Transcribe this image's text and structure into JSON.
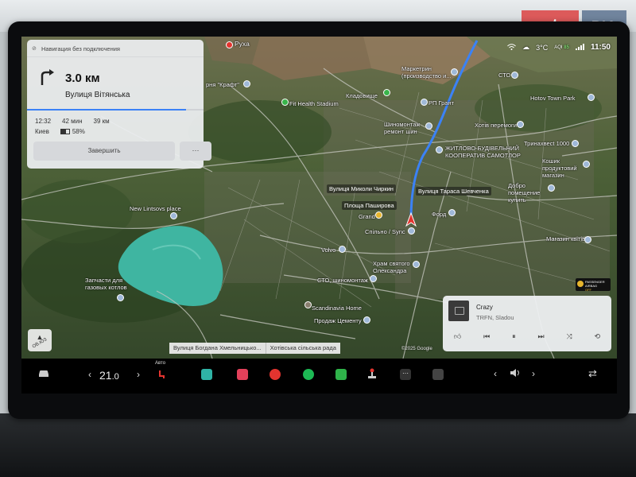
{
  "watermark": {
    "auto": "auto",
    "ria": "RIA"
  },
  "status": {
    "temperature": "3°C",
    "aqi_label": "AQI",
    "aqi_value": "85",
    "time": "11:50"
  },
  "navigation": {
    "header": "Навигация без подключения",
    "distance": "3.0 км",
    "street": "Вулиця Вітянська",
    "arrival_time": "12:32",
    "duration": "42 мин",
    "trip_distance": "39 км",
    "destination": "Киев",
    "battery_percent": "58%",
    "battery_level": 0.58,
    "progress": 0.9,
    "end_button": "Завершить",
    "more_button": "···"
  },
  "map": {
    "labels": [
      {
        "text": "Руха"
      },
      {
        "text": "Маркетрин (производство и..."
      },
      {
        "text": "рня \"Крафт\""
      },
      {
        "text": "Кладовище"
      },
      {
        "text": "Fit Health Stadium"
      },
      {
        "text": "РП Грант"
      },
      {
        "text": "СТО"
      },
      {
        "text": "Hotov Town Park"
      },
      {
        "text": "Шиномонтаж ремонт шин"
      },
      {
        "text": "Хотів перемоги"
      },
      {
        "text": "ЖИТЛОВО-БУДІВЕЛЬНИЙ КООПЕРАТИВ САМОТЛОР"
      },
      {
        "text": "Тринахвесt 1000"
      },
      {
        "text": "Кошик продуктовий магазин"
      },
      {
        "text": "Вулиця Миколи Чиркин"
      },
      {
        "text": "Вулиця Тараса Шевченка"
      },
      {
        "text": "Площа Паширова"
      },
      {
        "text": "Добро помещение купить"
      },
      {
        "text": "New Lintsovs place"
      },
      {
        "text": "Grand"
      },
      {
        "text": "Спільно / Sync"
      },
      {
        "text": "Форд"
      },
      {
        "text": "Магазин квітів"
      },
      {
        "text": "Volvo"
      },
      {
        "text": "Храм святого Олександра"
      },
      {
        "text": "СТО, шиномонтаж"
      },
      {
        "text": "Запчасти для газовых котлов"
      },
      {
        "text": "Scandinavia Home"
      },
      {
        "text": "Продаж Цементу"
      }
    ],
    "street_chips": [
      "Вулиця Богдана Хмельницько...",
      "Хотівська сільська рада"
    ],
    "google": "Google",
    "copyright": "©2025 Google",
    "compass": "ОВ.ЮЗ",
    "airbag": {
      "line1": "PASSENGER",
      "line2": "AIRBAG",
      "line3": "OFF"
    }
  },
  "music": {
    "title": "Crazy",
    "artist": "TRFN, Sladou"
  },
  "taskbar": {
    "temperature_int": "21",
    "temperature_dec": ".0",
    "auto_label": "Авто",
    "chevron_left": "‹",
    "chevron_right": "›"
  },
  "colors": {
    "route": "#3b82f6",
    "accent_red": "#e3342f",
    "lake": "#3fb5a1"
  }
}
